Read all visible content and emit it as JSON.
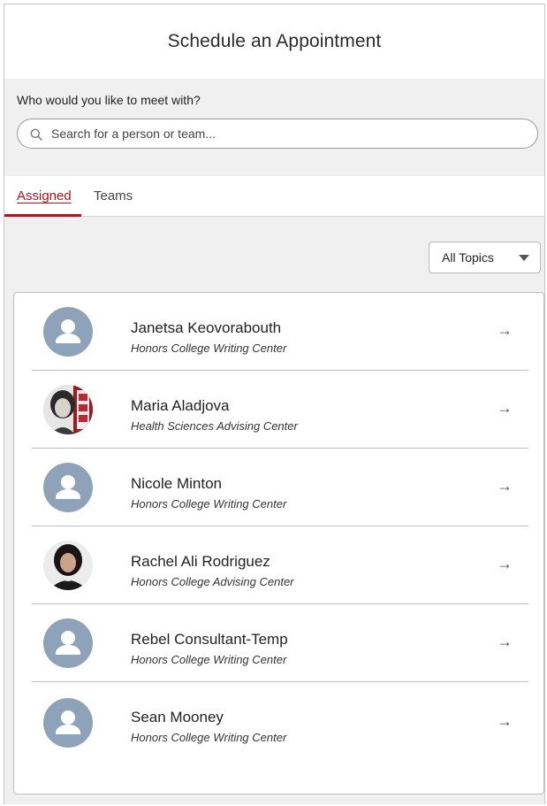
{
  "header": {
    "title": "Schedule an Appointment"
  },
  "search": {
    "label": "Who would you like to meet with?",
    "placeholder": "Search for a person or team...",
    "value": ""
  },
  "tabs": [
    {
      "label": "Assigned",
      "active": true
    },
    {
      "label": "Teams",
      "active": false
    }
  ],
  "filter": {
    "selected": "All Topics"
  },
  "people": [
    {
      "name": "Janetsa Keovorabouth",
      "department": "Honors College Writing Center",
      "avatar": "default"
    },
    {
      "name": "Maria Aladjova",
      "department": "Health Sciences Advising Center",
      "avatar": "photo"
    },
    {
      "name": "Nicole Minton",
      "department": "Honors College Writing Center",
      "avatar": "default"
    },
    {
      "name": "Rachel Ali Rodriguez",
      "department": "Honors College Advising Center",
      "avatar": "photo"
    },
    {
      "name": "Rebel Consultant-Temp",
      "department": "Honors College Writing Center",
      "avatar": "default"
    },
    {
      "name": "Sean Mooney",
      "department": "Honors College Writing Center",
      "avatar": "default"
    }
  ],
  "icons": {
    "search": "search-icon",
    "arrow": "arrow-right-icon",
    "caret": "caret-down-icon",
    "avatar": "person-icon"
  },
  "colors": {
    "accent": "#b3121e",
    "avatar_bg": "#8ea3b9",
    "page_bg": "#f0f0f0"
  }
}
